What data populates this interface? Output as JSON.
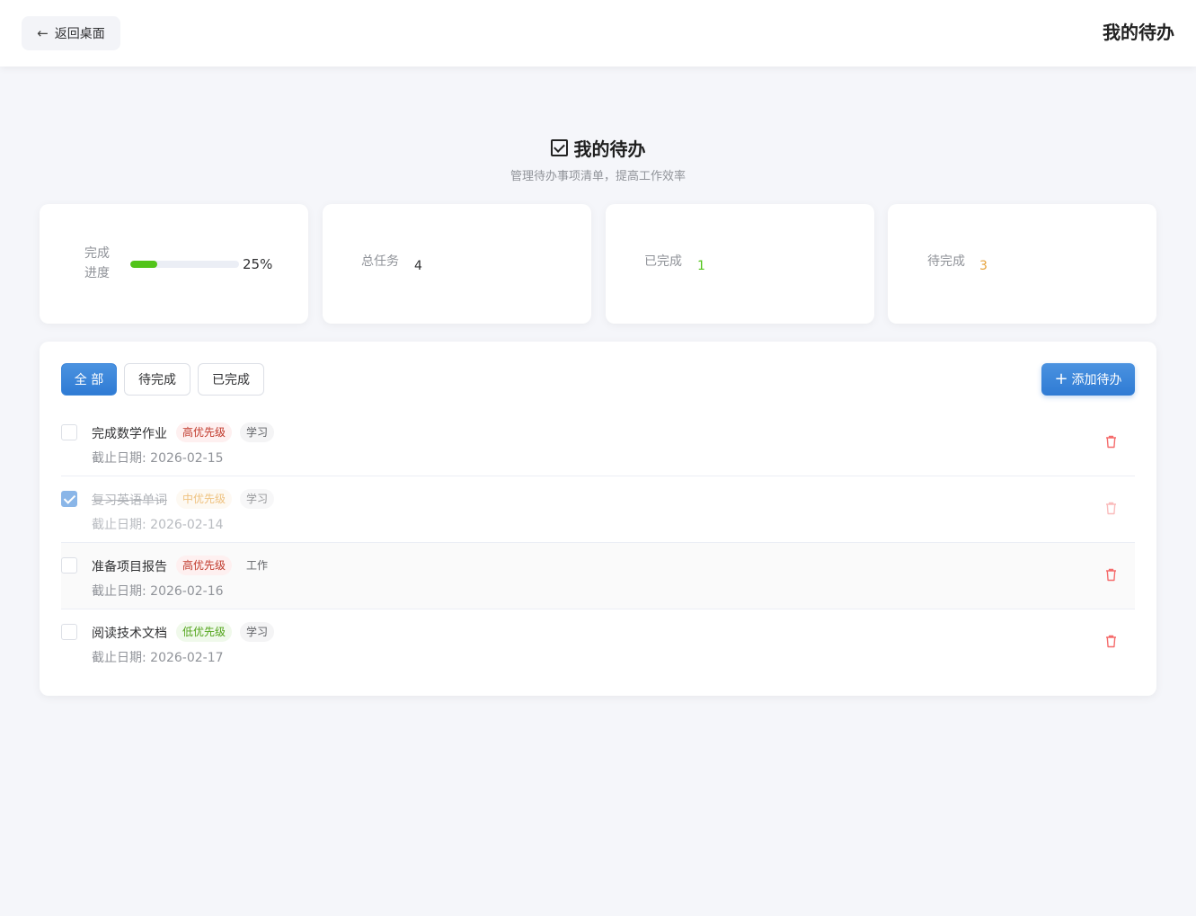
{
  "topbar": {
    "back_label": "返回桌面",
    "title": "我的待办"
  },
  "heading": {
    "title": "我的待办",
    "subtitle": "管理待办事项清单，提高工作效率"
  },
  "stats": {
    "progress": {
      "label": "完成进度",
      "percent": 25,
      "percent_text": "25%",
      "color": "#52c41a"
    },
    "total": {
      "label": "总任务",
      "value": "4"
    },
    "done": {
      "label": "已完成",
      "value": "1",
      "color": "#52c41a"
    },
    "pending": {
      "label": "待完成",
      "value": "3",
      "color": "#e6a23c"
    }
  },
  "filters": [
    {
      "label": "全 部",
      "active": true
    },
    {
      "label": "待完成",
      "active": false
    },
    {
      "label": "已完成",
      "active": false
    }
  ],
  "add_label": "添加待办",
  "colors": {
    "accent": "#2f7bd4",
    "danger": "#f56c6c"
  },
  "todos": [
    {
      "title": "完成数学作业",
      "priority": "高优先级",
      "priority_level": "high",
      "category": "学习",
      "due": "截止日期: 2026-02-15",
      "done": false
    },
    {
      "title": "复习英语单词",
      "priority": "中优先级",
      "priority_level": "mid",
      "category": "学习",
      "due": "截止日期: 2026-02-14",
      "done": true
    },
    {
      "title": "准备项目报告",
      "priority": "高优先级",
      "priority_level": "high",
      "category": "工作",
      "due": "截止日期: 2026-02-16",
      "done": false
    },
    {
      "title": "阅读技术文档",
      "priority": "低优先级",
      "priority_level": "low",
      "category": "学习",
      "due": "截止日期: 2026-02-17",
      "done": false
    }
  ]
}
